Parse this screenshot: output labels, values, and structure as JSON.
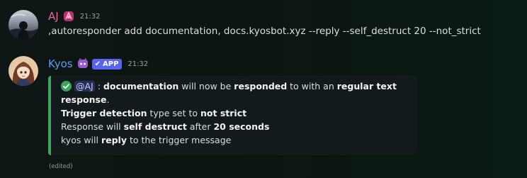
{
  "messages": [
    {
      "username": "AJ",
      "timestamp": "21:32",
      "content": ",autoresponder add documentation, docs.kyosbot.xyz --reply --self_destruct 20 --not_strict",
      "colors": {
        "username": "#e864a7"
      }
    },
    {
      "username": "Kyos",
      "badge": "APP",
      "timestamp": "21:32",
      "embed": {
        "accent_color": "#3ba55c",
        "line1": {
          "mention": "@AJ",
          "sep": " : ",
          "keyword": "documentation",
          "mid": " will now be ",
          "responded": "responded",
          "mid2": " to with an ",
          "regular_text": "regular text"
        },
        "line2": {
          "response": "response",
          "period": "."
        },
        "line3": {
          "trigger_detection": "Trigger detection",
          "mid": " type set to ",
          "not_strict": "not strict"
        },
        "line4": {
          "start": "Response will ",
          "self_destruct": "self destruct",
          "mid": " after ",
          "seconds": "20 seconds"
        },
        "line5": {
          "start": "kyos will ",
          "reply": "reply",
          "end": " to the trigger message"
        }
      },
      "edited": "(edited)",
      "colors": {
        "username": "#5d9bf2",
        "badge": "#5865f2"
      }
    }
  ]
}
